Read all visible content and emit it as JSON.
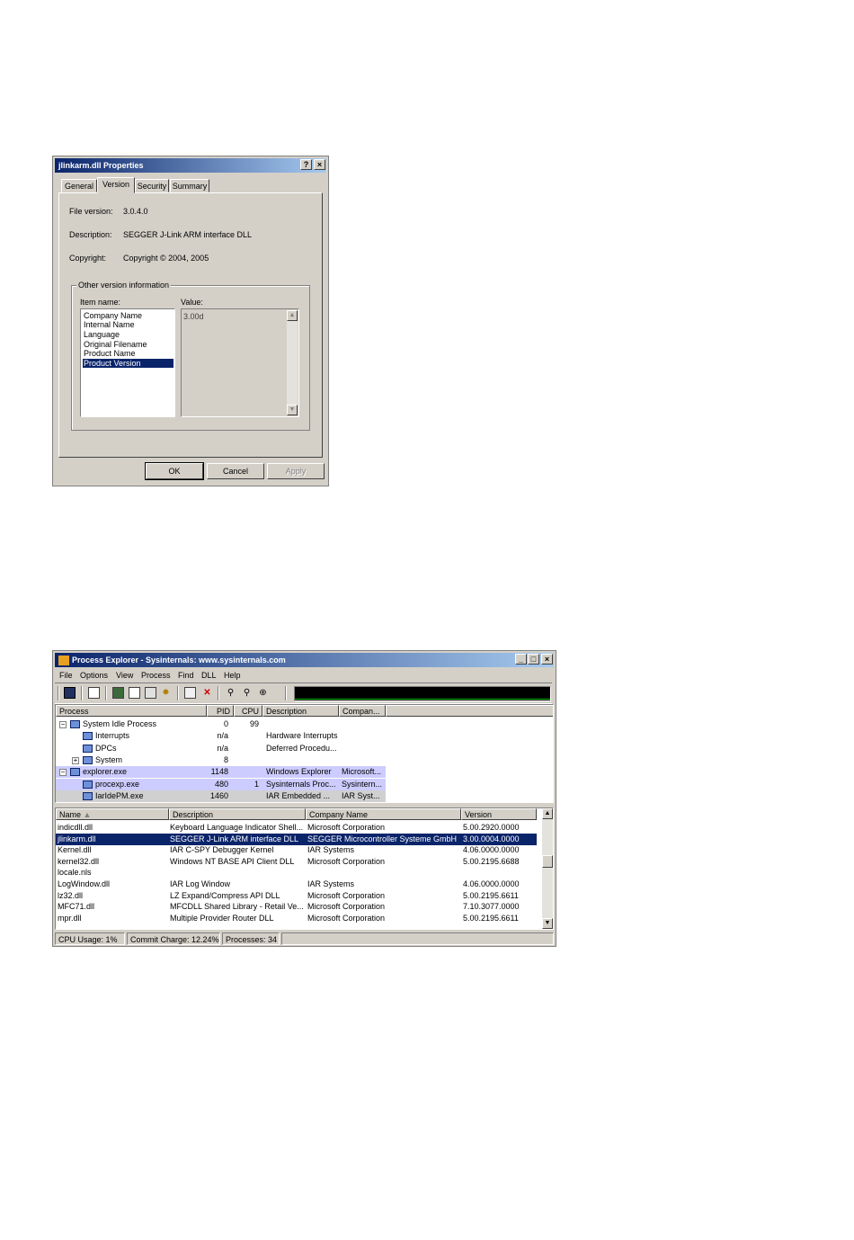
{
  "properties_dialog": {
    "title": "jlinkarm.dll Properties",
    "help_button": "?",
    "close_button": "×",
    "tabs": [
      "General",
      "Version",
      "Security",
      "Summary"
    ],
    "file_version_label": "File version:",
    "file_version": "3.0.4.0",
    "description_label": "Description:",
    "description": "SEGGER J-Link ARM interface DLL",
    "copyright_label": "Copyright:",
    "copyright": "Copyright © 2004, 2005",
    "group_title": "Other version information",
    "item_name_label": "Item name:",
    "value_label": "Value:",
    "items": [
      "Company Name",
      "Internal Name",
      "Language",
      "Original Filename",
      "Product Name",
      "Product Version"
    ],
    "selected_item": "Product Version",
    "value": "3.00d",
    "ok_label": "OK",
    "cancel_label": "Cancel",
    "apply_label": "Apply"
  },
  "process_explorer": {
    "title": "Process Explorer - Sysinternals: www.sysinternals.com",
    "menu": [
      "File",
      "Options",
      "View",
      "Process",
      "Find",
      "DLL",
      "Help"
    ],
    "process_columns": [
      "Process",
      "PID",
      "CPU",
      "Description",
      "Compan..."
    ],
    "processes": [
      {
        "name": "System Idle Process",
        "pid": "0",
        "cpu": "99",
        "desc": "",
        "company": "",
        "level": 0,
        "tree": "−"
      },
      {
        "name": "Interrupts",
        "pid": "n/a",
        "cpu": "",
        "desc": "Hardware Interrupts",
        "company": "",
        "level": 1,
        "tree": ""
      },
      {
        "name": "DPCs",
        "pid": "n/a",
        "cpu": "",
        "desc": "Deferred Procedu...",
        "company": "",
        "level": 1,
        "tree": ""
      },
      {
        "name": "System",
        "pid": "8",
        "cpu": "",
        "desc": "",
        "company": "",
        "level": 1,
        "tree": "+"
      },
      {
        "name": "explorer.exe",
        "pid": "1148",
        "cpu": "",
        "desc": "Windows Explorer",
        "company": "Microsoft...",
        "level": 0,
        "tree": "−"
      },
      {
        "name": "procexp.exe",
        "pid": "480",
        "cpu": "1",
        "desc": "Sysinternals Proc...",
        "company": "Sysintern...",
        "level": 1,
        "tree": ""
      },
      {
        "name": "IarIdePM.exe",
        "pid": "1460",
        "cpu": "",
        "desc": "IAR Embedded ...",
        "company": "IAR Syst...",
        "level": 1,
        "tree": ""
      }
    ],
    "dll_columns": [
      "Name",
      "Description",
      "Company Name",
      "Version"
    ],
    "dlls": [
      {
        "name": "indicdll.dll",
        "desc": "Keyboard Language Indicator Shell...",
        "company": "Microsoft Corporation",
        "version": "5.00.2920.0000"
      },
      {
        "name": "jlinkarm.dll",
        "desc": "SEGGER J-Link ARM interface DLL",
        "company": "SEGGER Microcontroller Systeme GmbH",
        "version": "3.00.0004.0000"
      },
      {
        "name": "Kernel.dll",
        "desc": "IAR C-SPY Debugger Kernel",
        "company": "IAR Systems",
        "version": "4.06.0000.0000"
      },
      {
        "name": "kernel32.dll",
        "desc": "Windows NT BASE API Client DLL",
        "company": "Microsoft Corporation",
        "version": "5.00.2195.6688"
      },
      {
        "name": "locale.nls",
        "desc": "",
        "company": "",
        "version": ""
      },
      {
        "name": "LogWindow.dll",
        "desc": "IAR Log Window",
        "company": "IAR Systems",
        "version": "4.06.0000.0000"
      },
      {
        "name": "lz32.dll",
        "desc": "LZ Expand/Compress API DLL",
        "company": "Microsoft Corporation",
        "version": "5.00.2195.6611"
      },
      {
        "name": "MFC71.dll",
        "desc": "MFCDLL Shared Library - Retail Ve...",
        "company": "Microsoft Corporation",
        "version": "7.10.3077.0000"
      },
      {
        "name": "mpr.dll",
        "desc": "Multiple Provider Router DLL",
        "company": "Microsoft Corporation",
        "version": "5.00.2195.6611"
      }
    ],
    "status": [
      "CPU Usage: 1%",
      "Commit Charge: 12.24%",
      "Processes: 34"
    ]
  },
  "colors": {
    "title_active": "#0a246a",
    "selection": "#0a246a",
    "highlight_process": "#ccccff",
    "cpu_graph": "#00c000"
  }
}
